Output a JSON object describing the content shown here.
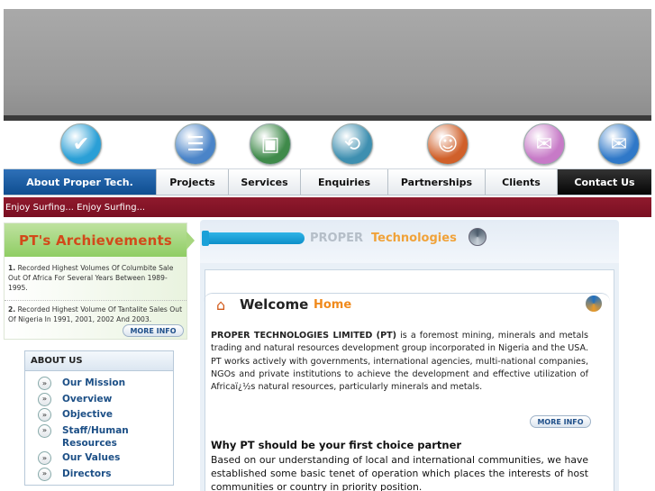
{
  "icons": [
    {
      "name": "check-icon",
      "glyph": "✔",
      "color": "#2a9fd6"
    },
    {
      "name": "document-list-icon",
      "glyph": "☰",
      "color": "#4a84c8"
    },
    {
      "name": "computer-icon",
      "glyph": "▣",
      "color": "#3f8a4a"
    },
    {
      "name": "refresh-arrows-icon",
      "glyph": "⟲",
      "color": "#3e8fb0"
    },
    {
      "name": "people-icon",
      "glyph": "☺",
      "color": "#d0602a"
    },
    {
      "name": "chat-bubble-icon",
      "glyph": "✉",
      "color": "#c77ac7"
    },
    {
      "name": "mail-globe-icon",
      "glyph": "✉",
      "color": "#2f78c8"
    }
  ],
  "nav": {
    "items": [
      "About Proper Tech.",
      "Projects",
      "Services",
      "Enquiries",
      "Partnerships",
      "Clients",
      "Contact Us"
    ]
  },
  "marquee": "Enjoy Surfing... Enjoy Surfing...",
  "achievements": {
    "title": "PT's Archievements",
    "item1_num": "1.",
    "item1": " Recorded Highest Volumes Of Columbite Sale Out Of Africa For Several Years Between 1989-1995.",
    "item2_num": "2.",
    "item2": " Recorded Highest Volume Of Tantalite Sales Out Of Nigeria In 1991, 2001, 2002 And 2003.",
    "more": "MORE INFO"
  },
  "about": {
    "title": "ABOUT US",
    "items": [
      "Our Mission",
      "Overview",
      "Objective",
      "Staff/Human Resources",
      "Our Values",
      "Directors"
    ]
  },
  "content": {
    "brand1": "PROPER",
    "brand2": "Technologies",
    "welcome": "Welcome",
    "home": "Home",
    "intro_bold": "PROPER TECHNOLOGIES LIMITED (PT)",
    "intro": " is a foremost mining, minerals and metals trading and natural resources development group incorporated in Nigeria and the USA. PT works actively with governments, international agencies, multi-national companies, NGOs and private institutions to achieve the development and effective utilization of Africaï¿½s natural resources, particularly minerals and metals.",
    "more": "MORE INFO",
    "why": "Why PT should be your first choice partner",
    "why_text": "Based on our understanding of local and international communities, we have established some basic tenet of operation which places the interests of host communities or country in priority position."
  }
}
